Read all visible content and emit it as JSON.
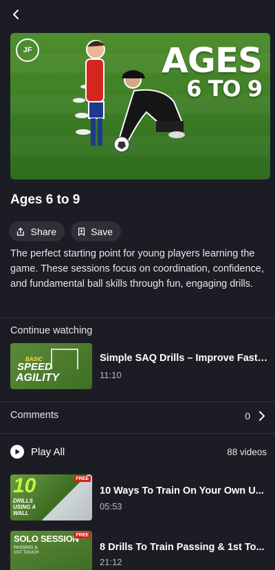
{
  "header": {
    "back_icon": "chevron-left-icon"
  },
  "hero": {
    "title_line1": "AGES",
    "title_line2": "6 TO 9",
    "logo_text": "JF"
  },
  "playlist": {
    "title": "Ages 6 to 9",
    "share_label": "Share",
    "save_label": "Save",
    "description": "The perfect starting point for young players learning the game. These sessions focus on coordination, confidence, and fundamental ball skills through fun, engaging drills."
  },
  "continue_watching": {
    "label": "Continue watching",
    "thumb": {
      "line1": "BASIC",
      "line2": "SPEED",
      "line3": "AGILITY"
    },
    "title": "Simple SAQ Drills – Improve Fast ...",
    "duration": "11:10"
  },
  "comments": {
    "label": "Comments",
    "count": "0"
  },
  "play_all": {
    "label": "Play All",
    "count": "88 videos"
  },
  "videos": [
    {
      "title": "10 Ways To Train On Your Own U...",
      "duration": "05:53",
      "badge": "FREE",
      "thumb_big": "10",
      "thumb_small": "DRILLS USING A WALL"
    },
    {
      "title": "8 Drills To Train Passing & 1st To...",
      "duration": "21:12",
      "badge": "FREE",
      "thumb_big": "SOLO SESSION",
      "thumb_small": "PASSING & 1ST TOUCH"
    }
  ]
}
